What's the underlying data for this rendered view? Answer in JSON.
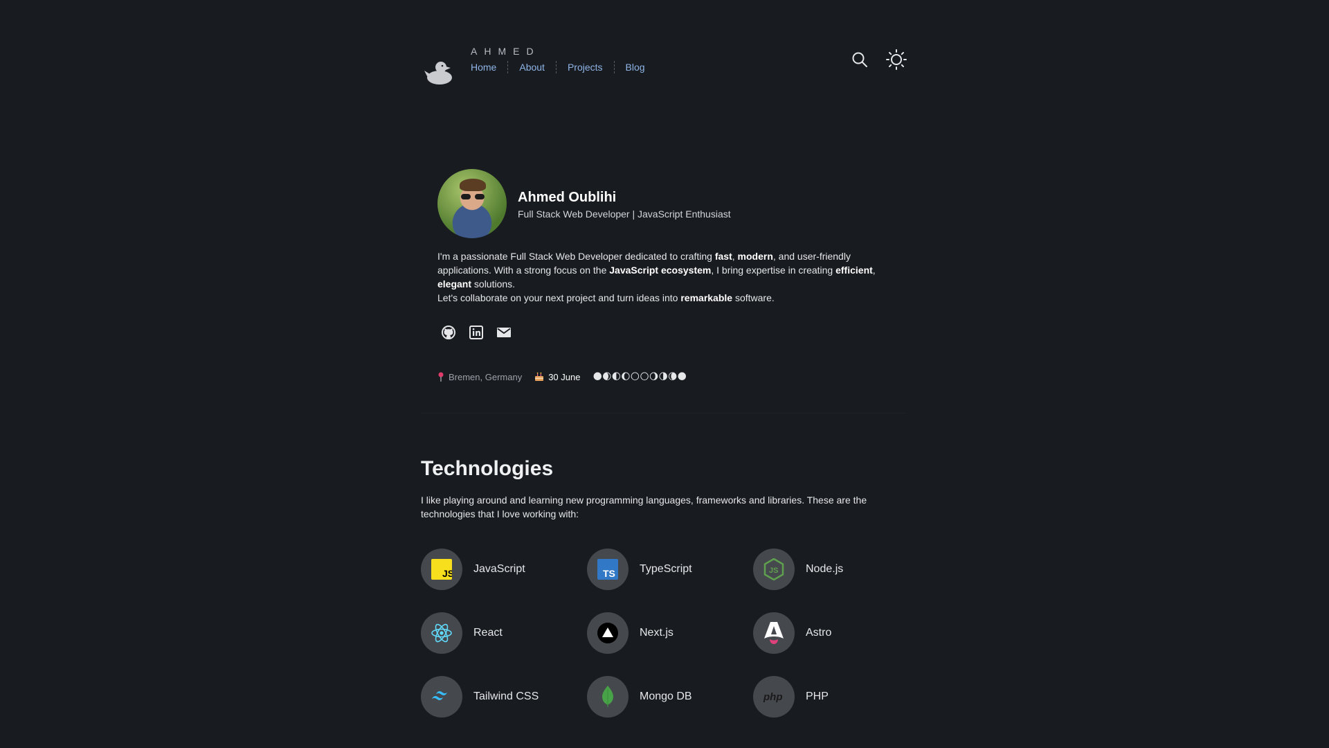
{
  "brand": {
    "name": "AHMED"
  },
  "nav": {
    "items": [
      "Home",
      "About",
      "Projects",
      "Blog"
    ]
  },
  "header": {
    "search_icon": "search-icon",
    "theme_icon": "sun-icon"
  },
  "profile": {
    "name": "Ahmed Oublihi",
    "role": "Full Stack Web Developer | JavaScript Enthusiast",
    "bio": {
      "p1_a": "I'm a passionate Full Stack Web Developer dedicated to crafting ",
      "p1_b1": "fast",
      "p1_c": ", ",
      "p1_b2": "modern",
      "p1_d": ", and user-friendly applications. With a strong focus on the ",
      "p1_b3": "JavaScript ecosystem",
      "p1_e": ", I bring expertise in creating ",
      "p1_b4": "efficient",
      "p1_f": ", ",
      "p1_b5": "elegant",
      "p1_g": " solutions.",
      "p2_a": "Let's collaborate on your next project and turn ideas into ",
      "p2_b": "remarkable",
      "p2_c": " software."
    },
    "socials": [
      "github-icon",
      "linkedin-icon",
      "email-icon"
    ],
    "location": "Bremen, Germany",
    "birthday": "30 June",
    "moon_phases": "🌑🌒🌓🌔🌕🌕🌖🌗🌘🌑"
  },
  "technologies": {
    "title": "Technologies",
    "description": "I like playing around and learning new programming languages, frameworks and libraries. These are the technologies that I love working with:",
    "items": [
      {
        "label": "JavaScript",
        "icon": "javascript-icon",
        "color": "#f7df1e"
      },
      {
        "label": "TypeScript",
        "icon": "typescript-icon",
        "color": "#3178c6"
      },
      {
        "label": "Node.js",
        "icon": "nodejs-icon",
        "color": "#5fa04e"
      },
      {
        "label": "React",
        "icon": "react-icon",
        "color": "#61dafb"
      },
      {
        "label": "Next.js",
        "icon": "nextjs-icon",
        "color": "#000000"
      },
      {
        "label": "Astro",
        "icon": "astro-icon",
        "color": "#ff5d01"
      },
      {
        "label": "Tailwind CSS",
        "icon": "tailwind-icon",
        "color": "#38bdf8"
      },
      {
        "label": "Mongo DB",
        "icon": "mongodb-icon",
        "color": "#47a248"
      },
      {
        "label": "PHP",
        "icon": "php-icon",
        "color": "#1a1a1a"
      }
    ]
  }
}
